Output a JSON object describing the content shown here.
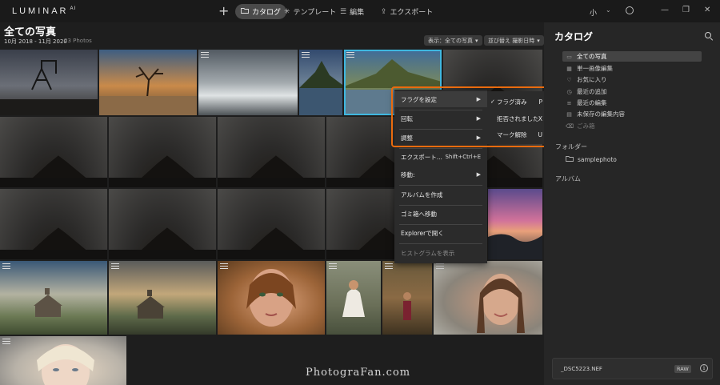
{
  "app": {
    "logo": "LUMINAR",
    "logo_sup": "AI"
  },
  "toolbar": {
    "add": "+",
    "tabs": [
      {
        "label": "カタログ",
        "icon": "folder-icon"
      },
      {
        "label": "テンプレート",
        "icon": "sparkle-icon"
      },
      {
        "label": "編集",
        "icon": "sliders-icon"
      },
      {
        "label": "エクスポート",
        "icon": "export-icon"
      }
    ],
    "zoom": "小",
    "chevron": "⌄"
  },
  "window_controls": {
    "minimize": "—",
    "maximize": "❐",
    "close": "✕"
  },
  "header": {
    "title": "全ての写真",
    "date_range": "10月 2018 - 11月 2020",
    "count": "23 Photos",
    "view_filter": "表示：全ての写真",
    "sort": "並び替え 撮影日時"
  },
  "context_menu": {
    "items": [
      {
        "label": "フラグを設定",
        "arrow": "▶"
      },
      {
        "label": "回転",
        "arrow": "▶"
      },
      {
        "label": "調整",
        "arrow": "▶"
      },
      {
        "label": "エクスポート...",
        "shortcut": "Shift+Ctrl+E"
      },
      {
        "label": "移動:",
        "arrow": "▶"
      },
      {
        "label": "アルバムを作成"
      },
      {
        "label": "ゴミ箱へ移動"
      },
      {
        "label": "Explorerで開く"
      },
      {
        "label": "ヒストグラムを表示"
      }
    ]
  },
  "flag_submenu": {
    "items": [
      {
        "check": "✓",
        "label": "フラグ済み",
        "key": "P"
      },
      {
        "check": "",
        "label": "拒否されました",
        "key": "X"
      },
      {
        "check": "",
        "label": "マーク解除",
        "key": "U"
      }
    ]
  },
  "panel": {
    "title": "カタログ",
    "catalog_items": [
      {
        "label": "全ての写真",
        "icon": "▭"
      },
      {
        "label": "単一画像編集",
        "icon": "▦"
      },
      {
        "label": "お気に入り",
        "icon": "♡"
      },
      {
        "label": "最近の追加",
        "icon": "◷"
      },
      {
        "label": "最近の編集",
        "icon": "≡"
      },
      {
        "label": "未保存の編集内容",
        "icon": "▤"
      },
      {
        "label": "ごみ箱",
        "icon": "⌫"
      }
    ],
    "folders_label": "フォルダー",
    "folder": "samplephoto",
    "albums_label": "アルバム",
    "file": {
      "name": "_DSC5223.NEF",
      "badge": "RAW",
      "info": "i"
    }
  },
  "watermark": "PhotograFan.com",
  "colors": {
    "selection": "#3fb7df",
    "annotation": "#ea6b0e",
    "panel_bg": "#262626"
  }
}
